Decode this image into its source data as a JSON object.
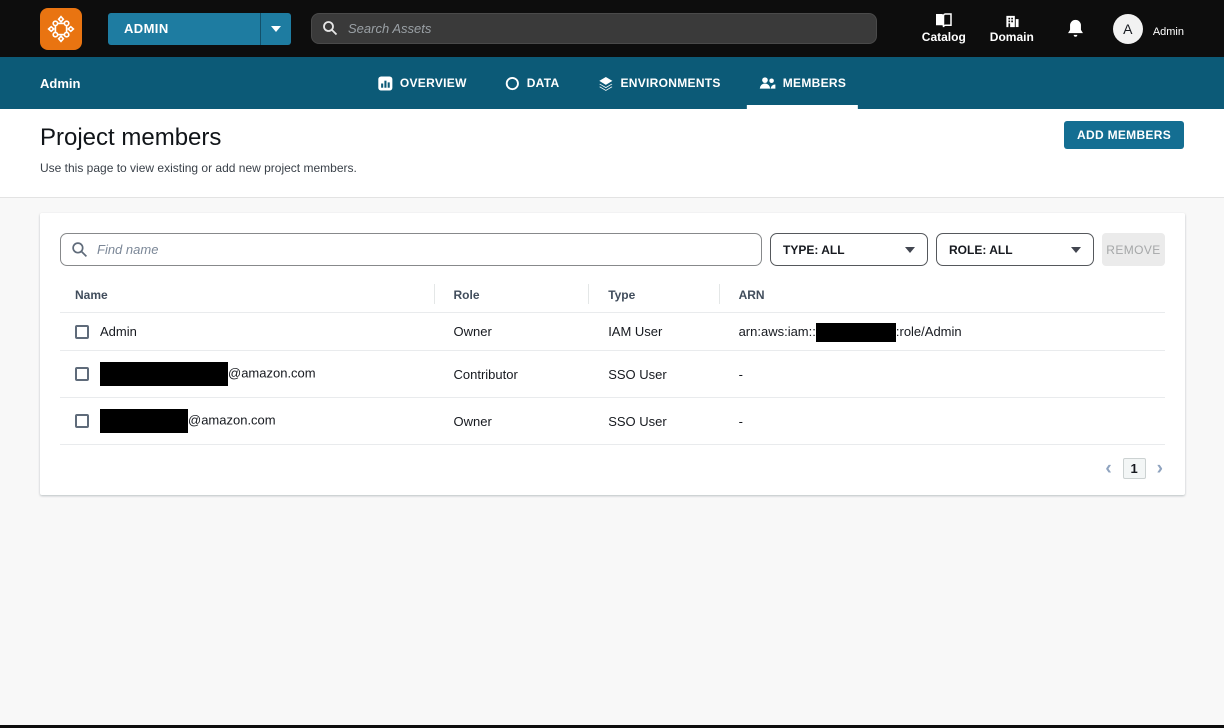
{
  "colors": {
    "topbar": "#0d0d0d",
    "nav_bar": "#0c5a77",
    "primary_button": "#146e92",
    "logo_orange": "#e97411",
    "active_tab_underline": "#ffffff"
  },
  "topbar": {
    "project_button_label": "ADMIN",
    "search_placeholder": "Search Assets",
    "catalog_label": "Catalog",
    "domain_label": "Domain",
    "avatar_initial": "A",
    "user_name": "Admin"
  },
  "nav": {
    "project_name": "Admin",
    "tabs": [
      {
        "label": "OVERVIEW",
        "active": false
      },
      {
        "label": "DATA",
        "active": false
      },
      {
        "label": "ENVIRONMENTS",
        "active": false
      },
      {
        "label": "MEMBERS",
        "active": true
      }
    ]
  },
  "page": {
    "title": "Project members",
    "subtitle": "Use this page to view existing or add new project members.",
    "add_members_button": "ADD MEMBERS"
  },
  "toolbar": {
    "find_placeholder": "Find name",
    "type_filter_value": "TYPE: ALL",
    "role_filter_value": "ROLE: ALL",
    "remove_button": "REMOVE"
  },
  "table": {
    "columns": [
      "Name",
      "Role",
      "Type",
      "ARN"
    ],
    "rows": [
      {
        "name": "Admin",
        "role": "Owner",
        "type": "IAM User",
        "arn_prefix": "arn:aws:iam::",
        "arn_suffix": ":role/Admin"
      },
      {
        "name_suffix": "@amazon.com",
        "role": "Contributor",
        "type": "SSO User",
        "arn": "-"
      },
      {
        "name_suffix": "@amazon.com",
        "role": "Owner",
        "type": "SSO User",
        "arn": "-"
      }
    ]
  },
  "pagination": {
    "prev_icon": "‹",
    "current_page": "1",
    "next_icon": "›"
  }
}
